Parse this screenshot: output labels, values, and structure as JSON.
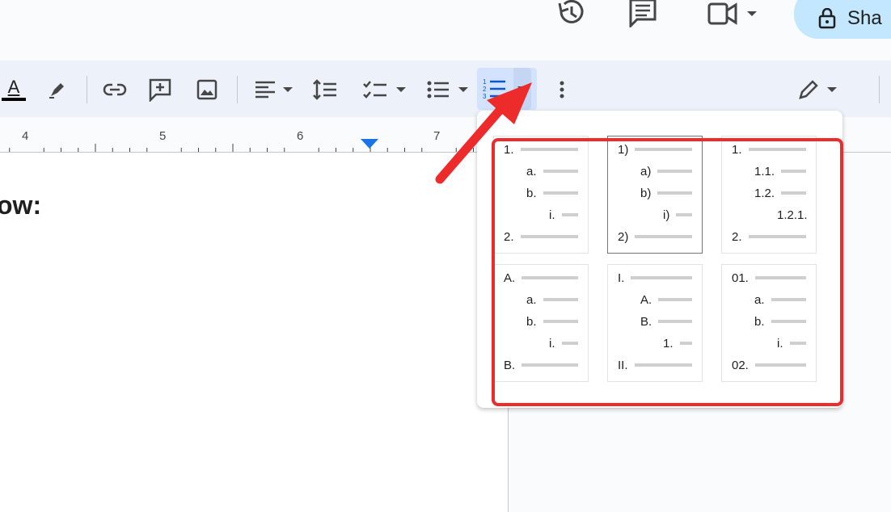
{
  "header": {
    "icons": [
      "version-history-icon",
      "comments-icon",
      "meet-icon"
    ],
    "share_label": "Sha"
  },
  "toolbar": {
    "text_color_letter": "A",
    "items": [
      "text-color",
      "highlight",
      "insert-link",
      "add-comment",
      "insert-image",
      "align",
      "line-spacing",
      "checklist",
      "bulleted-list",
      "numbered-list",
      "more",
      "editing-mode"
    ]
  },
  "ruler": {
    "numbers": [
      "4",
      "5",
      "6",
      "7"
    ]
  },
  "document": {
    "visible_text": "ow:"
  },
  "numbered_list_menu": {
    "presets": [
      {
        "rows": [
          {
            "label": "1.",
            "level": 0
          },
          {
            "label": "a.",
            "level": 1
          },
          {
            "label": "b.",
            "level": 1
          },
          {
            "label": "i.",
            "level": 2
          },
          {
            "label": "2.",
            "level": 0
          }
        ]
      },
      {
        "rows": [
          {
            "label": "1)",
            "level": 0
          },
          {
            "label": "a)",
            "level": 1
          },
          {
            "label": "b)",
            "level": 1
          },
          {
            "label": "i)",
            "level": 2
          },
          {
            "label": "2)",
            "level": 0
          }
        ],
        "selected": true
      },
      {
        "rows": [
          {
            "label": "1.",
            "level": 0
          },
          {
            "label": "1.1.",
            "level": 1
          },
          {
            "label": "1.2.",
            "level": 1
          },
          {
            "label": "1.2.1.",
            "level": 2
          },
          {
            "label": "2.",
            "level": 0
          }
        ]
      },
      {
        "rows": [
          {
            "label": "A.",
            "level": 0
          },
          {
            "label": "a.",
            "level": 1
          },
          {
            "label": "b.",
            "level": 1
          },
          {
            "label": "i.",
            "level": 2
          },
          {
            "label": "B.",
            "level": 0
          }
        ]
      },
      {
        "rows": [
          {
            "label": "I.",
            "level": 0
          },
          {
            "label": "A.",
            "level": 1
          },
          {
            "label": "B.",
            "level": 1
          },
          {
            "label": "1.",
            "level": 2
          },
          {
            "label": "II.",
            "level": 0
          }
        ]
      },
      {
        "rows": [
          {
            "label": "01.",
            "level": 0
          },
          {
            "label": "a.",
            "level": 1
          },
          {
            "label": "b.",
            "level": 1
          },
          {
            "label": "i.",
            "level": 2
          },
          {
            "label": "02.",
            "level": 0
          }
        ]
      }
    ]
  },
  "colors": {
    "annotation": "#ee2b2b",
    "toolbar_bg": "#edf2fa",
    "share_bg": "#c2e7ff",
    "active_button_bg": "#d3e3fd"
  }
}
